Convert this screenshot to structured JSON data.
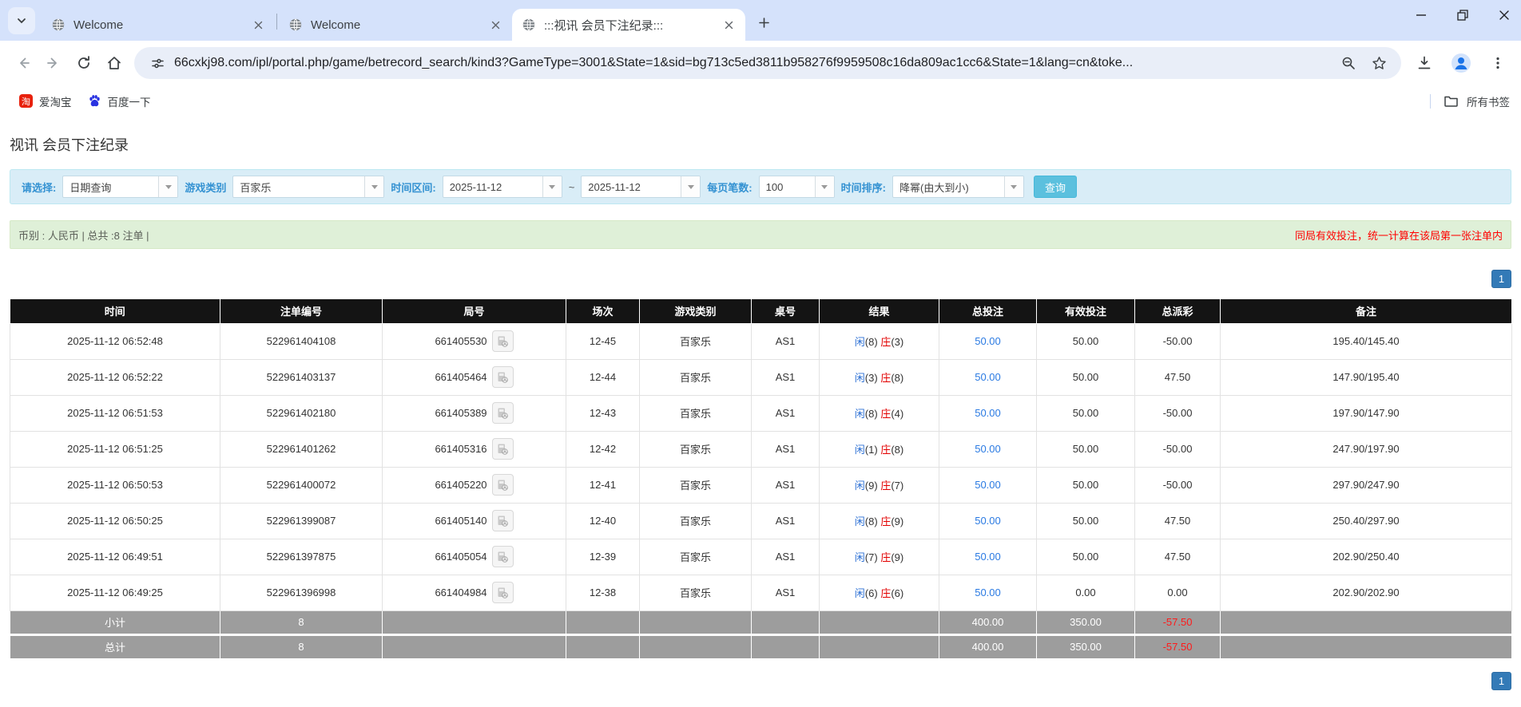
{
  "browser": {
    "tabs": [
      {
        "title": "Welcome",
        "active": false
      },
      {
        "title": "Welcome",
        "active": false
      },
      {
        "title": ":::视讯 会员下注纪录:::",
        "active": true
      }
    ],
    "url": "66cxkj98.com/ipl/portal.php/game/betrecord_search/kind3?GameType=3001&State=1&sid=bg713c5ed3811b958276f9959508c16da809ac1cc6&State=1&lang=cn&toke...",
    "bookmarks": {
      "taobao": "爱淘宝",
      "baidu": "百度一下",
      "taobao_icon_char": "淘",
      "all_bookmarks": "所有书签"
    }
  },
  "page": {
    "title": "视讯 会员下注纪录",
    "filters": {
      "select_label": "请选择:",
      "select_value": "日期查询",
      "game_type_label": "游戏类别",
      "game_type_value": "百家乐",
      "date_range_label": "时间区间:",
      "date_from": "2025-11-12",
      "date_separator": "~",
      "date_to": "2025-11-12",
      "page_size_label": "每页笔数:",
      "page_size_value": "100",
      "sort_label": "时间排序:",
      "sort_value": "降幂(由大到小)",
      "query_button": "查询"
    },
    "info_bar": {
      "left": "币别 : 人民币 | 总共 :8 注单 |",
      "right": "同局有效投注，统一计算在该局第一张注单内"
    },
    "pagination_top": "1",
    "pagination_bottom": "1"
  },
  "table": {
    "headers": [
      "时间",
      "注单编号",
      "局号",
      "场次",
      "游戏类别",
      "桌号",
      "结果",
      "总投注",
      "有效投注",
      "总派彩",
      "备注"
    ],
    "rows": [
      {
        "time": "2025-11-12 06:52:48",
        "bet_id": "522961404108",
        "round_id": "661405530",
        "session": "12-45",
        "game": "百家乐",
        "table_no": "AS1",
        "player": "闲",
        "player_num": "(8)",
        "banker": "庄",
        "banker_num": "(3)",
        "total_bet": "50.00",
        "valid_bet": "50.00",
        "payout": "-50.00",
        "note": "195.40/145.40"
      },
      {
        "time": "2025-11-12 06:52:22",
        "bet_id": "522961403137",
        "round_id": "661405464",
        "session": "12-44",
        "game": "百家乐",
        "table_no": "AS1",
        "player": "闲",
        "player_num": "(3)",
        "banker": "庄",
        "banker_num": "(8)",
        "total_bet": "50.00",
        "valid_bet": "50.00",
        "payout": "47.50",
        "note": "147.90/195.40"
      },
      {
        "time": "2025-11-12 06:51:53",
        "bet_id": "522961402180",
        "round_id": "661405389",
        "session": "12-43",
        "game": "百家乐",
        "table_no": "AS1",
        "player": "闲",
        "player_num": "(8)",
        "banker": "庄",
        "banker_num": "(4)",
        "total_bet": "50.00",
        "valid_bet": "50.00",
        "payout": "-50.00",
        "note": "197.90/147.90"
      },
      {
        "time": "2025-11-12 06:51:25",
        "bet_id": "522961401262",
        "round_id": "661405316",
        "session": "12-42",
        "game": "百家乐",
        "table_no": "AS1",
        "player": "闲",
        "player_num": "(1)",
        "banker": "庄",
        "banker_num": "(8)",
        "total_bet": "50.00",
        "valid_bet": "50.00",
        "payout": "-50.00",
        "note": "247.90/197.90"
      },
      {
        "time": "2025-11-12 06:50:53",
        "bet_id": "522961400072",
        "round_id": "661405220",
        "session": "12-41",
        "game": "百家乐",
        "table_no": "AS1",
        "player": "闲",
        "player_num": "(9)",
        "banker": "庄",
        "banker_num": "(7)",
        "total_bet": "50.00",
        "valid_bet": "50.00",
        "payout": "-50.00",
        "note": "297.90/247.90"
      },
      {
        "time": "2025-11-12 06:50:25",
        "bet_id": "522961399087",
        "round_id": "661405140",
        "session": "12-40",
        "game": "百家乐",
        "table_no": "AS1",
        "player": "闲",
        "player_num": "(8)",
        "banker": "庄",
        "banker_num": "(9)",
        "total_bet": "50.00",
        "valid_bet": "50.00",
        "payout": "47.50",
        "note": "250.40/297.90"
      },
      {
        "time": "2025-11-12 06:49:51",
        "bet_id": "522961397875",
        "round_id": "661405054",
        "session": "12-39",
        "game": "百家乐",
        "table_no": "AS1",
        "player": "闲",
        "player_num": "(7)",
        "banker": "庄",
        "banker_num": "(9)",
        "total_bet": "50.00",
        "valid_bet": "50.00",
        "payout": "47.50",
        "note": "202.90/250.40"
      },
      {
        "time": "2025-11-12 06:49:25",
        "bet_id": "522961396998",
        "round_id": "661404984",
        "session": "12-38",
        "game": "百家乐",
        "table_no": "AS1",
        "player": "闲",
        "player_num": "(6)",
        "banker": "庄",
        "banker_num": "(6)",
        "total_bet": "50.00",
        "valid_bet": "0.00",
        "payout": "0.00",
        "note": "202.90/202.90"
      }
    ],
    "subtotal": {
      "label": "小计",
      "count": "8",
      "total_bet": "400.00",
      "valid_bet": "350.00",
      "payout": "-57.50"
    },
    "total": {
      "label": "总计",
      "count": "8",
      "total_bet": "400.00",
      "valid_bet": "350.00",
      "payout": "-57.50"
    }
  },
  "colors": {
    "query_button": "#5bc0de",
    "pagination": "#337ab7",
    "header_bg": "#141414",
    "player_blue": "#2b6fd4",
    "banker_red": "#e20000",
    "amount_blue": "#2a7ae2",
    "negative_red": "#ff0000",
    "footer_gray": "#9d9d9d",
    "info_green": "#dff0d8",
    "filter_blue": "#d9edf7"
  }
}
